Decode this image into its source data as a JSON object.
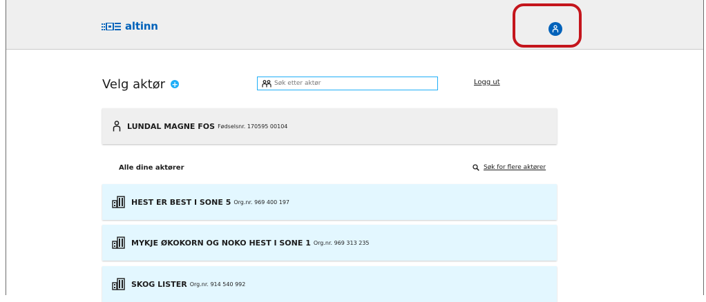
{
  "header": {
    "logo_text": "altinn",
    "profile_icon": "user-icon",
    "highlight_color": "#c4151c"
  },
  "main": {
    "title": "Velg aktør",
    "add_icon": "+",
    "search_placeholder": "Søk etter aktør",
    "logout_label": "Logg ut",
    "current_actor": {
      "name": "LUNDAL MAGNE FOS",
      "id_text": "Fødselsnr. 170595 00104",
      "icon": "person-icon"
    },
    "section_title": "Alle dine aktører",
    "more_actors_label": "Søk for flere aktører",
    "organizations": [
      {
        "name": "HEST ER BEST I SONE 5",
        "org_no": "Org.nr. 969 400 197",
        "icon": "building-icon"
      },
      {
        "name": "MYKJE ØKOKORN OG NOKO HEST I SONE 1",
        "org_no": "Org.nr. 969 313 235",
        "icon": "building-icon"
      },
      {
        "name": "SKOG LISTER",
        "org_no": "Org.nr. 914 540 992",
        "icon": "building-icon"
      }
    ]
  },
  "colors": {
    "brand_blue": "#0062ba",
    "accent_blue": "#1eaef7",
    "org_card_bg": "#e3f7ff",
    "person_card_bg": "#efefef"
  }
}
